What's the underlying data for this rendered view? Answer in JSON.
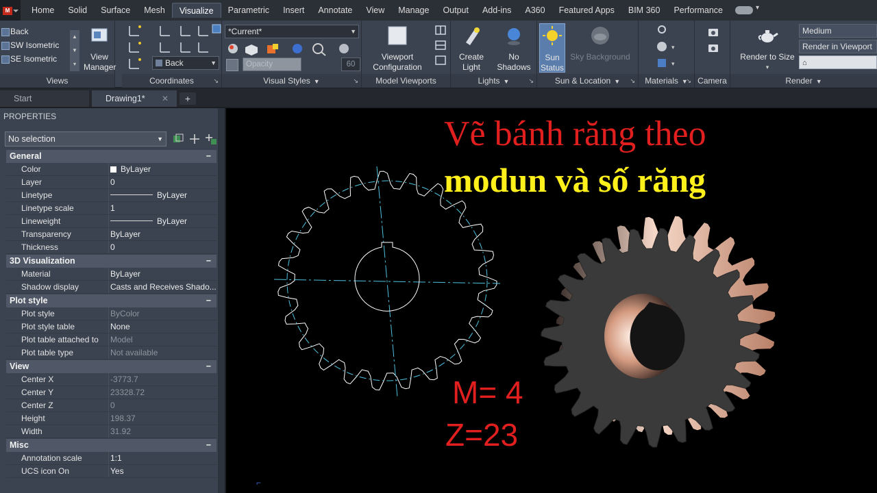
{
  "menu": {
    "tabs": [
      "Home",
      "Solid",
      "Surface",
      "Mesh",
      "Visualize",
      "Parametric",
      "Insert",
      "Annotate",
      "View",
      "Manage",
      "Output",
      "Add-ins",
      "A360",
      "Featured Apps",
      "BIM 360",
      "Performance"
    ],
    "active_tab": "Visualize",
    "app_letter": "M"
  },
  "ribbon": {
    "views": {
      "items": [
        "Back",
        "SW Isometric",
        "SE Isometric"
      ],
      "title": "Views",
      "view_manager_label": "View Manager"
    },
    "coordinates": {
      "title": "Coordinates",
      "ucs_dropdown": "Back"
    },
    "visual_styles": {
      "current": "*Current*",
      "opacity_label": "Opacity",
      "opacity_value": "60",
      "title": "Visual Styles"
    },
    "model_viewports": {
      "button_label": "Viewport Configuration",
      "title": "Model Viewports"
    },
    "lights": {
      "create_label": "Create Light",
      "no_shadows_label": "No Shadows",
      "title": "Lights"
    },
    "sun_location": {
      "sun_status_label": "Sun Status",
      "sky_label": "Sky Background",
      "title": "Sun & Location"
    },
    "materials": {
      "title": "Materials"
    },
    "camera": {
      "title": "Camera"
    },
    "render": {
      "quality": "Medium",
      "target": "Render in Viewport",
      "render_size_label": "Render to Size",
      "title": "Render"
    }
  },
  "doc_tabs": [
    {
      "label": "Start",
      "active": false
    },
    {
      "label": "Drawing1*",
      "active": true
    }
  ],
  "properties": {
    "title": "PROPERTIES",
    "selection": "No selection",
    "sections": [
      {
        "name": "General",
        "rows": [
          {
            "key": "Color",
            "value": "ByLayer",
            "kind": "swatch"
          },
          {
            "key": "Layer",
            "value": "0"
          },
          {
            "key": "Linetype",
            "value": "ByLayer",
            "kind": "line"
          },
          {
            "key": "Linetype scale",
            "value": "1"
          },
          {
            "key": "Lineweight",
            "value": "ByLayer",
            "kind": "line"
          },
          {
            "key": "Transparency",
            "value": "ByLayer"
          },
          {
            "key": "Thickness",
            "value": "0"
          }
        ]
      },
      {
        "name": "3D Visualization",
        "rows": [
          {
            "key": "Material",
            "value": "ByLayer"
          },
          {
            "key": "Shadow display",
            "value": "Casts  and  Receives  Shado..."
          }
        ]
      },
      {
        "name": "Plot style",
        "rows": [
          {
            "key": "Plot style",
            "value": "ByColor",
            "dim": true
          },
          {
            "key": "Plot style table",
            "value": "None"
          },
          {
            "key": "Plot table attached to",
            "value": "Model",
            "dim": true
          },
          {
            "key": "Plot table type",
            "value": "Not available",
            "dim": true
          }
        ]
      },
      {
        "name": "View",
        "rows": [
          {
            "key": "Center X",
            "value": "-3773.7",
            "dim": true
          },
          {
            "key": "Center Y",
            "value": "23328.72",
            "dim": true
          },
          {
            "key": "Center Z",
            "value": "0",
            "dim": true
          },
          {
            "key": "Height",
            "value": "198.37",
            "dim": true
          },
          {
            "key": "Width",
            "value": "31.92",
            "dim": true
          }
        ]
      },
      {
        "name": "Misc",
        "rows": [
          {
            "key": "Annotation scale",
            "value": "1:1"
          },
          {
            "key": "UCS icon On",
            "value": "Yes"
          }
        ]
      }
    ]
  },
  "canvas": {
    "title_line1": "Vẽ bánh răng theo",
    "title_line2": "modun và số răng",
    "module_text": "M= 4",
    "teeth_text": "Z=23",
    "colors": {
      "title_red": "#e21f1f",
      "title_yellow": "#ffef1a",
      "background": "#000000"
    }
  },
  "gear": {
    "module": 4,
    "teeth": 23
  }
}
